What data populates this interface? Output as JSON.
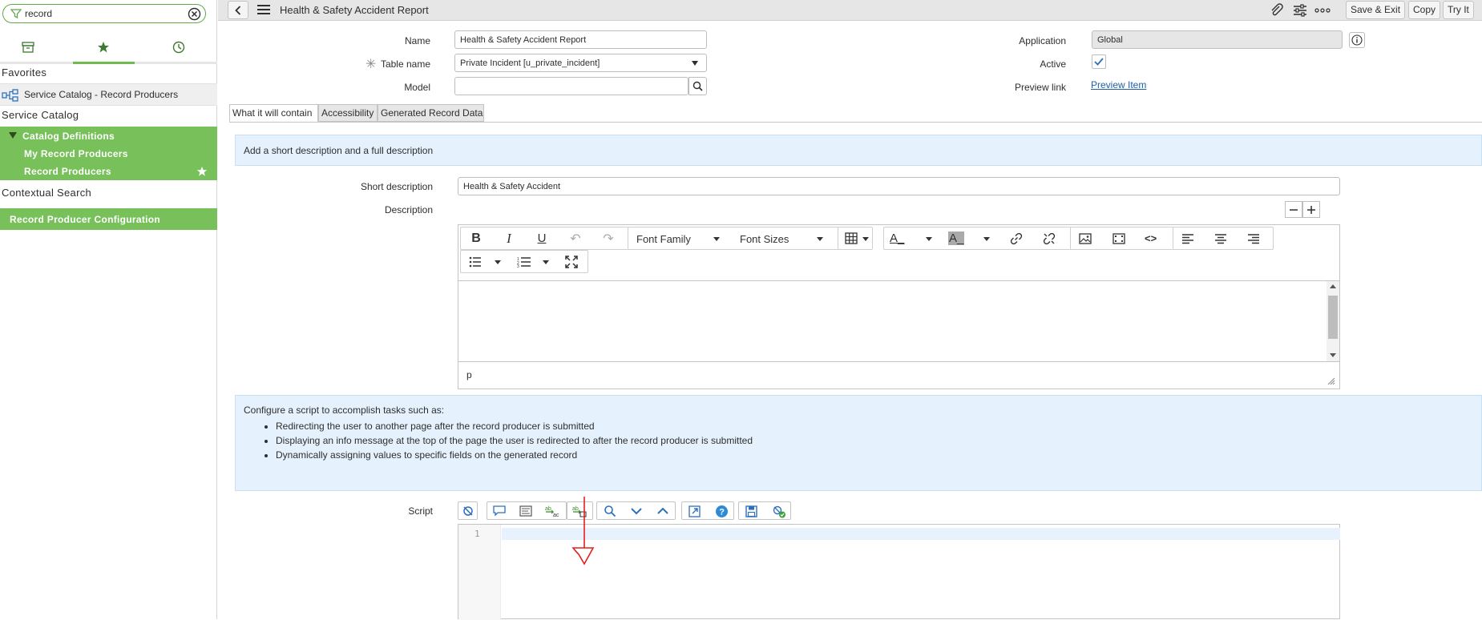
{
  "nav": {
    "filter_value": "record",
    "favorites_title": "Favorites",
    "favorite_item": "Service Catalog - Record Producers",
    "service_catalog_title": "Service Catalog",
    "catalog_definitions": "Catalog Definitions",
    "my_record_producers": "My Record Producers",
    "record_producers": "Record Producers",
    "contextual_search": "Contextual Search",
    "record_producer_configuration": "Record Producer Configuration"
  },
  "header": {
    "title": "Health & Safety Accident Report",
    "save_exit": "Save & Exit",
    "copy": "Copy",
    "try_it": "Try It"
  },
  "form": {
    "name_label": "Name",
    "name_value": "Health & Safety Accident Report",
    "table_label": "Table name",
    "table_value": "Private Incident [u_private_incident]",
    "model_label": "Model",
    "model_value": "",
    "application_label": "Application",
    "application_value": "Global",
    "active_label": "Active",
    "preview_label": "Preview link",
    "preview_value": "Preview Item"
  },
  "tabs": [
    "What it will contain",
    "Accessibility",
    "Generated Record Data"
  ],
  "content": {
    "info1": "Add a short description and a full description",
    "short_desc_label": "Short description",
    "short_desc_value": "Health & Safety Accident",
    "description_label": "Description",
    "font_family": "Font Family",
    "font_sizes": "Font Sizes",
    "status_path": "p",
    "info2_title": "Configure a script to accomplish tasks such as:",
    "info2_items": [
      "Redirecting the user to another page after the record producer is submitted",
      "Displaying an info message at the top of the page the user is redirected to after the record producer is submitted",
      "Dynamically assigning values to specific fields on the generated record"
    ],
    "script_label": "Script",
    "line_number": "1"
  },
  "colors": {
    "nav_green": "#77c05a",
    "info_blue": "#e5f2fd",
    "link_blue": "#1f5fa6",
    "annotation_red": "#e02020"
  }
}
